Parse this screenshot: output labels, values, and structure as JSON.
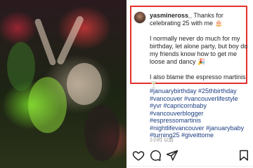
{
  "post": {
    "username": "yasmineross_",
    "caption_intro": " Thanks for celebrating 25 with me 🎂",
    "caption_body": "I normally never do much for my birthday, let alone party, but boy do my friends know how to get me loose and dancy 🎉",
    "caption_closing": "I also blame the espresso martinis 🍸",
    "hashtags": [
      "#januarybirthday #25thbirthday",
      "#vancouver #vancouverlifestyle",
      "#yvr #capricornbaby",
      "#vancouverblogger",
      "#espressomartinis",
      "#nightlifevancouver #januarybaby",
      "#turning25 #giveittome"
    ],
    "timestamp": "1小时 以前"
  },
  "icons": {
    "like": "heart-icon",
    "comment": "comment-icon",
    "share": "paper-plane-icon",
    "save": "bookmark-icon"
  },
  "colors": {
    "highlight_border": "#e5302b",
    "hashtag": "#1c3f82",
    "text": "#262626"
  }
}
